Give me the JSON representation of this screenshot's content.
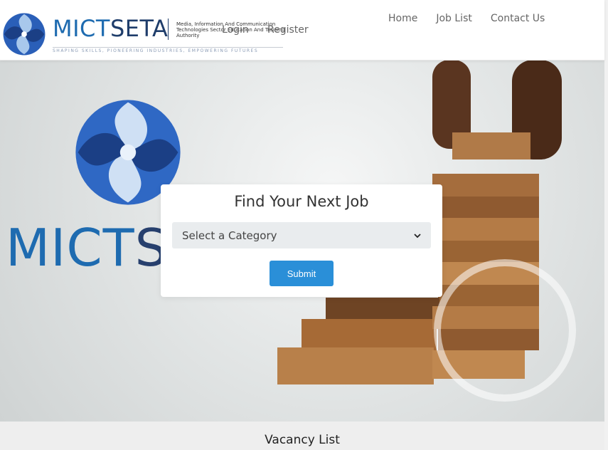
{
  "header": {
    "brand_part1": "MICT",
    "brand_part2": "SETA",
    "brand_description": "Media, Information And Communication Technologies Sector Education And Training Authority",
    "tagline": "SHAPING SKILLS, PIONEERING INDUSTRIES, EMPOWERING FUTURES",
    "login_label": "Login",
    "register_label": "Register"
  },
  "nav": {
    "items": [
      {
        "label": "Home"
      },
      {
        "label": "Job List"
      },
      {
        "label": "Contact Us"
      }
    ]
  },
  "hero": {
    "brand_part1": "MICT",
    "brand_part2": "SE"
  },
  "search": {
    "title": "Find Your Next Job",
    "category_placeholder": "Select a Category",
    "submit_label": "Submit"
  },
  "vacancy": {
    "title": "Vacancy List"
  },
  "colors": {
    "brand_blue": "#1e6bb0",
    "brand_navy": "#1f3d6b",
    "button_blue": "#2a8fd8"
  },
  "icons": {
    "dropdown": "chevron-down-icon",
    "logo": "mictseta-swirl-logo"
  }
}
